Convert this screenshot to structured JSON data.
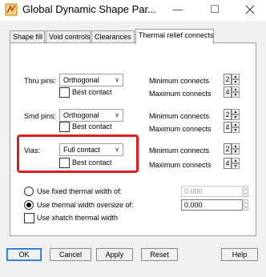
{
  "window": {
    "title": "Global Dynamic Shape Par...",
    "minimize_glyph": "—",
    "maximize_glyph": "☐"
  },
  "tabs": [
    {
      "label": "Shape fill",
      "active": false
    },
    {
      "label": "Void controls",
      "active": false
    },
    {
      "label": "Clearances",
      "active": false
    },
    {
      "label": "Thermal relief connects",
      "active": true
    }
  ],
  "rows": [
    {
      "label": "Thru pins:",
      "select_value": "Orthogonal",
      "best_contact_label": "Best contact",
      "best_contact_checked": false,
      "min_label": "Minimum connects",
      "min_value": "2",
      "max_label": "Maximum connects",
      "max_value": "4"
    },
    {
      "label": "Smd pins:",
      "select_value": "Orthogonal",
      "best_contact_label": "Best contact",
      "best_contact_checked": false,
      "min_label": "Minimum connects",
      "min_value": "2",
      "max_label": "Maximum connects",
      "max_value": "4"
    },
    {
      "label": "Vias:",
      "select_value": "Full contact",
      "best_contact_label": "Best contact",
      "best_contact_checked": false,
      "min_label": "Minimum connects",
      "min_value": "2",
      "max_label": "Maximum connects",
      "max_value": "4"
    }
  ],
  "thermal": {
    "fixed_label": "Use fixed thermal width of:",
    "fixed_value": "0.000",
    "oversize_label": "Use thermal width oversize of:",
    "oversize_value": "0.000",
    "xhatch_label": "Use xhatch thermal width",
    "selected_option": "oversize"
  },
  "buttons": {
    "ok": "OK",
    "cancel": "Cancel",
    "apply": "Apply",
    "reset": "Reset",
    "help": "Help"
  },
  "colors": {
    "highlight": "#e01b1b",
    "default_button_border": "#1a6ad0"
  }
}
